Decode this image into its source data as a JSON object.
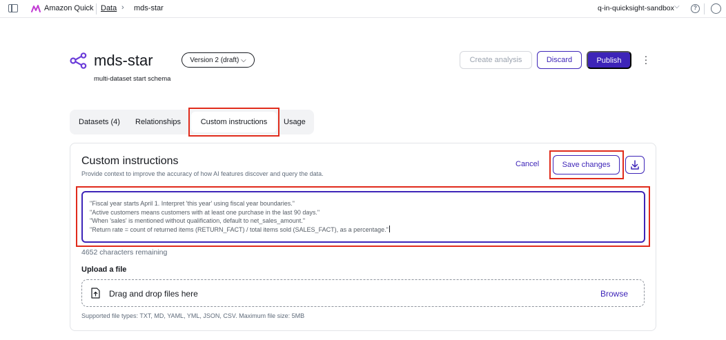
{
  "topbar": {
    "brand": "Amazon Quick",
    "breadcrumb_root": "Data",
    "breadcrumb_current": "mds-star",
    "account": "q-in-quicksight-sandbox"
  },
  "header": {
    "title": "mds-star",
    "version": "Version 2 (draft)",
    "subtitle": "multi-dataset start schema",
    "create_analysis_label": "Create analysis",
    "discard_label": "Discard",
    "publish_label": "Publish"
  },
  "tabs": [
    {
      "label": "Datasets (4)"
    },
    {
      "label": "Relationships"
    },
    {
      "label": "Custom instructions",
      "active": true
    },
    {
      "label": "Usage"
    }
  ],
  "panel": {
    "title": "Custom instructions",
    "description": "Provide context to improve the accuracy of how AI features discover and query the data.",
    "cancel_label": "Cancel",
    "save_label": "Save changes",
    "instructions": [
      "\"Fiscal year starts April 1. Interpret 'this year' using fiscal year boundaries.\"",
      "\"Active customers means customers with at least one purchase in the last 90 days.\"",
      "\"When 'sales' is mentioned without qualification, default to net_sales_amount.\"",
      "\"Return rate = count of returned items (RETURN_FACT) / total items sold (SALES_FACT), as a percentage.\""
    ],
    "chars_remaining": "4652 characters remaining",
    "upload_label": "Upload a file",
    "dropzone_text": "Drag and drop files here",
    "browse_label": "Browse",
    "supported_types": "Supported file types: TXT, MD, YAML, YML, JSON, CSV. Maximum file size: 5MB"
  },
  "colors": {
    "accent": "#3d24b8",
    "highlight": "#e02a1a"
  }
}
